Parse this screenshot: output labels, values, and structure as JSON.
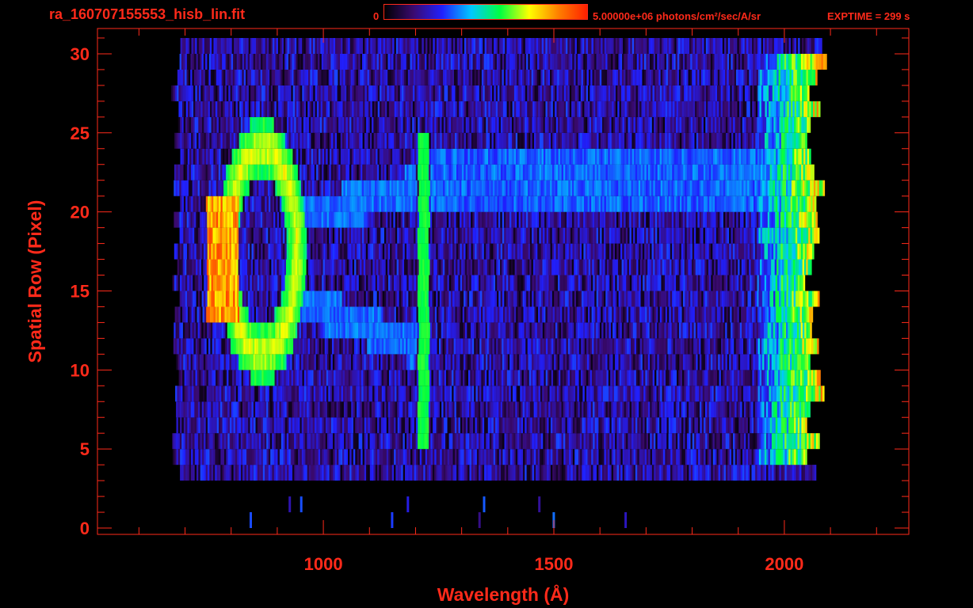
{
  "header": {
    "title": "ra_160707155553_hisb_lin.fit",
    "colorbar_min": "0",
    "colorbar_max_label": "5.00000e+06 photons/cm²/sec/A/sr",
    "exptime": "EXPTIME = 299 s"
  },
  "colors": {
    "axis": "#ff2a1a",
    "background": "#000000",
    "colormap": [
      "#000000",
      "#3a0a6e",
      "#2020ff",
      "#00c8ff",
      "#00ff40",
      "#ffff00",
      "#ff8000",
      "#ff2000"
    ]
  },
  "chart_data": {
    "type": "heatmap",
    "title": "ra_160707155553_hisb_lin.fit",
    "xlabel": "Wavelength (Å)",
    "ylabel": "Spatial Row (Pixel)",
    "xlim": [
      510,
      2270
    ],
    "ylim": [
      -0.4,
      31.6
    ],
    "x_ticks": [
      1000,
      1500,
      2000
    ],
    "y_ticks": [
      0,
      5,
      10,
      15,
      20,
      25,
      30
    ],
    "x_minor_step": 100,
    "y_minor_step": 1,
    "grid": false,
    "colorbar": {
      "min": 0,
      "max": 5000000,
      "unit": "photons/cm²/sec/A/sr"
    },
    "data_extent": {
      "x": [
        680,
        2090
      ],
      "rows": [
        3,
        30
      ]
    },
    "features": [
      {
        "name": "Lyman-alpha line",
        "x_center": 1216,
        "x_halfwidth": 12,
        "rows": [
          5,
          24
        ],
        "intensity": 0.55
      },
      {
        "name": "ring feature",
        "x_center": 865,
        "x_radius": 75,
        "row_center": 17,
        "row_radius": 6.5,
        "intensity": 0.5
      },
      {
        "name": "ring bright edge",
        "x": 780,
        "rows": [
          13,
          20
        ],
        "intensity": 0.9
      },
      {
        "name": "diagonal streak upper",
        "from": [
          930,
          19
        ],
        "to": [
          1200,
          21
        ],
        "intensity": 0.3
      },
      {
        "name": "diagonal streak lower",
        "from": [
          930,
          14
        ],
        "to": [
          1200,
          11
        ],
        "intensity": 0.3
      },
      {
        "name": "band rows 20-23",
        "x": [
          1230,
          1990
        ],
        "rows": [
          20,
          23
        ],
        "intensity": 0.28
      },
      {
        "name": "red edge",
        "x": [
          1940,
          2080
        ],
        "rows": [
          4,
          29
        ],
        "intensity": 0.45
      }
    ]
  }
}
